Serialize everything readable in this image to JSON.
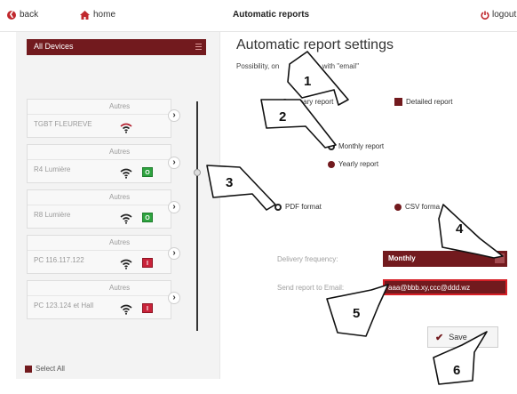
{
  "topbar": {
    "back": "back",
    "home": "home",
    "title": "Automatic reports",
    "logout": "logout"
  },
  "sidebar": {
    "device_filter": "All Devices",
    "devices": [
      {
        "type": "Autres",
        "name": "TGBT FLEUREVE",
        "status": ""
      },
      {
        "type": "Autres",
        "name": "R4 Lumière",
        "status": "O"
      },
      {
        "type": "Autres",
        "name": "R8 Lumière",
        "status": "O"
      },
      {
        "type": "Autres",
        "name": "PC 116.117.122",
        "status": "I"
      },
      {
        "type": "Autres",
        "name": "PC 123.124 et Hall",
        "status": "I"
      }
    ],
    "select_all": "Select All"
  },
  "main": {
    "title": "Automatic report settings",
    "subtitle_start": "Possibility, on",
    "subtitle_end": "with \"email\"",
    "report_types": {
      "summary": "Summary report",
      "detailed": "Detailed report"
    },
    "periods": {
      "monthly": "Monthly report",
      "yearly": "Yearly report"
    },
    "formats": {
      "pdf": "PDF format",
      "csv": "CSV forma"
    },
    "frequency_label": "Delivery frequency:",
    "frequency_value": "Monthly",
    "email_label": "Send report to Email:",
    "email_value": "aaa@bbb.xy,ccc@ddd.wz",
    "save": "Save"
  },
  "annotations": [
    "1",
    "2",
    "3",
    "4",
    "5",
    "6"
  ],
  "colors": {
    "accent": "#721a1e",
    "on_badge": "#2ea33f",
    "off_badge": "#c9233a",
    "focus_border": "#d61f26"
  }
}
